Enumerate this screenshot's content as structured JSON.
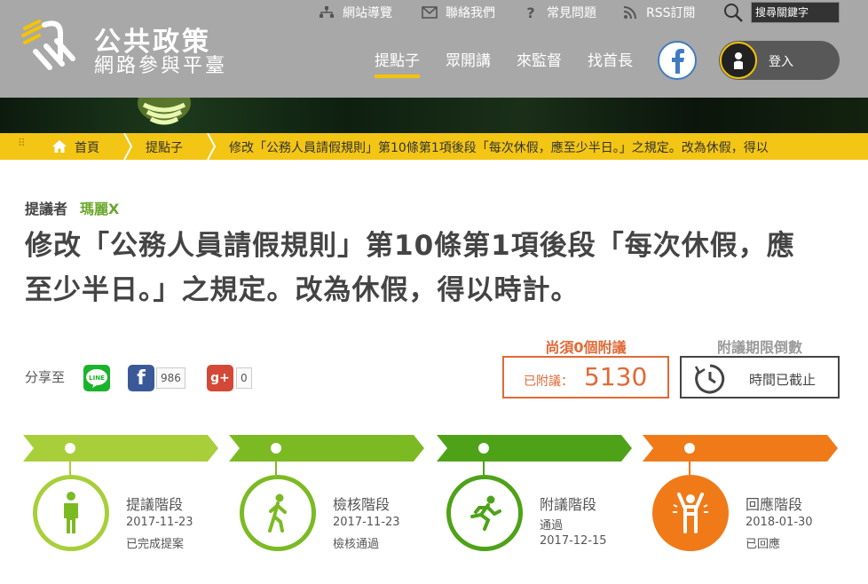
{
  "site": {
    "logo_title": "公共政策",
    "logo_subtitle": "網路參與平臺"
  },
  "utility": {
    "sitemap": "網站導覽",
    "contact": "聯絡我們",
    "faq": "常見問題",
    "rss": "RSS訂閱",
    "search_placeholder": "搜尋關鍵字"
  },
  "nav": {
    "items": [
      "提點子",
      "眾開講",
      "來監督",
      "找首長"
    ],
    "active_index": 0,
    "login": "登入"
  },
  "breadcrumb": {
    "home": "首頁",
    "section": "提點子",
    "current": "修改「公務人員請假規則」第10條第1項後段「每次休假，應至少半日。」之規定。改為休假，得以"
  },
  "proposal": {
    "proposer_label": "提議者",
    "proposer_name": "瑪麗X",
    "title": "修改「公務人員請假規則」第10條第1項後段「每次休假，應至少半日。」之規定。改為休假，得以時計。"
  },
  "share": {
    "label": "分享至",
    "line_label": "LINE",
    "facebook_count": "986",
    "gplus_count": "0"
  },
  "signatures": {
    "needed_label": "尚須0個附議",
    "signed_label": "已附議：",
    "signed_count": "5130",
    "countdown_label": "附議期限倒數",
    "countdown_status": "時間已截止"
  },
  "stages": [
    {
      "name": "提議階段",
      "date": "2017-11-23",
      "status": "已完成提案",
      "color": "#a8cf3a"
    },
    {
      "name": "檢核階段",
      "date": "2017-11-23",
      "status": "檢核通過",
      "color": "#7cba24"
    },
    {
      "name": "附議階段",
      "status": "通過",
      "date": "2017-12-15",
      "color": "#4ea218"
    },
    {
      "name": "回應階段",
      "date": "2018-01-30",
      "status": "已回應",
      "color": "#f07a18"
    }
  ],
  "colors": {
    "header_bg": "#a8a8a8",
    "accent_yellow": "#f3c514",
    "signature_orange": "#e06a37",
    "proposer_green": "#6aa62b"
  }
}
